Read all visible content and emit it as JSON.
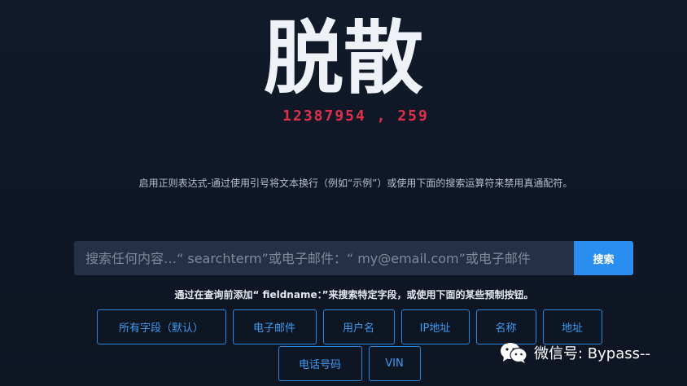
{
  "header": {
    "title": "脱散",
    "record_count": "12387954 , 259"
  },
  "description": "启用正则表达式-通过使用引号将文本换行（例如“示例”）或使用下面的搜索运算符来禁用真通配符。",
  "search": {
    "placeholder": "搜索任何内容…“ searchterm”或电子邮件：“ my@email.com”或电子邮件",
    "value": "",
    "button_label": "搜索"
  },
  "hint": "通过在查询前添加“ fieldname：”来搜索特定字段，或使用下面的某些预制按钮。",
  "filters": {
    "row1": [
      "所有字段（默认）",
      "电子邮件",
      "用户名",
      "IP地址",
      "名称",
      "地址"
    ],
    "row2": [
      "电话号码",
      "VIN"
    ]
  },
  "watermark": {
    "icon": "wechat-icon",
    "text": "微信号: Bypass--"
  },
  "colors": {
    "background": "#0f1726",
    "accent_red": "#e0314b",
    "accent_blue": "#2a8ef0",
    "input_bg": "#233045"
  }
}
